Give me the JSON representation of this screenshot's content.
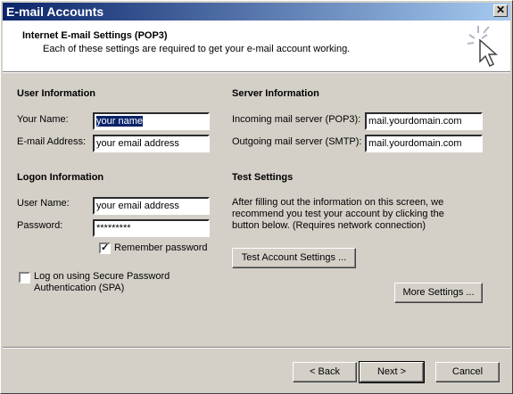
{
  "window": {
    "title": "E-mail Accounts",
    "close_glyph": "✕"
  },
  "header": {
    "title": "Internet E-mail Settings (POP3)",
    "subtitle": "Each of these settings are required to get your e-mail account working.",
    "icon": "cursor-sparkle-icon"
  },
  "user_info": {
    "heading": "User Information",
    "name_label": "Your Name:",
    "name_value": "your name",
    "email_label": "E-mail Address:",
    "email_value": "your email address"
  },
  "server_info": {
    "heading": "Server Information",
    "incoming_label": "Incoming mail server (POP3):",
    "incoming_value": "mail.yourdomain.com",
    "outgoing_label": "Outgoing mail server (SMTP):",
    "outgoing_value": "mail.yourdomain.com"
  },
  "logon_info": {
    "heading": "Logon Information",
    "user_label": "User Name:",
    "user_value": "your email address",
    "password_label": "Password:",
    "password_value": "*********",
    "remember_label": "Remember password",
    "remember_checked": true,
    "spa_label_1": "Log on using Secure Password",
    "spa_label_2": "Authentication (SPA)",
    "spa_checked": false
  },
  "test_settings": {
    "heading": "Test Settings",
    "line1": "After filling out the information on this screen, we",
    "line2": "recommend you test your account by clicking the",
    "line3": "button below. (Requires network connection)",
    "test_button": "Test Account Settings ...",
    "more_button": "More Settings ..."
  },
  "footer": {
    "back": "< Back",
    "next": "Next >",
    "cancel": "Cancel"
  }
}
